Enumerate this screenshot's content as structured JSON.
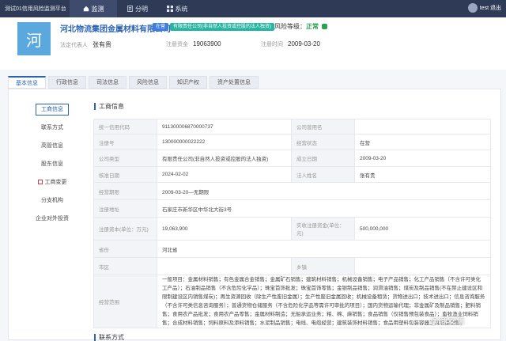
{
  "header": {
    "app_title": "测试01信用风险监测平台",
    "nav": [
      {
        "label": "监测",
        "icon": "home-icon"
      },
      {
        "label": "分明",
        "icon": "document-icon"
      },
      {
        "label": "系统",
        "icon": "grid-icon"
      }
    ],
    "user": "test 退出"
  },
  "company": {
    "logo_char": "河",
    "name": "河北物流集团金属材料有限公司",
    "tag_status": "在营",
    "tag_type": "有限责任公司(非自然人投资或控股的法人独资)",
    "risk_label": "风险等级：",
    "risk_level": "正常",
    "legal_rep_label": "法定代表人",
    "legal_rep": "张有贵",
    "capital_label": "注册资金",
    "capital": "19063900",
    "reg_time_label": "注册时间",
    "reg_time": "2009-03-20"
  },
  "tabs": [
    "基本信息",
    "行政信息",
    "司法信息",
    "风险信息",
    "知识产权",
    "资产处置信息"
  ],
  "sidemenu": [
    "工商信息",
    "联系方式",
    "高管信息",
    "股东信息",
    "工商变更",
    "分支机构",
    "企业对外投资"
  ],
  "section_title": "工商信息",
  "rows": [
    {
      "k1": "统一信用代码",
      "v1": "911300006870000737",
      "k2": "公司曾用名",
      "v2": ""
    },
    {
      "k1": "注册号",
      "v1": "130000000022222",
      "k2": "经营状态",
      "v2": "在营"
    },
    {
      "k1": "公司类型",
      "v1": "有限责任公司(非自然人投资或控股的法人独资)",
      "k2": "成立日期",
      "v2": "2009-03-20"
    },
    {
      "k1": "核准日期",
      "v1": "2024-02-02",
      "k2": "法人姓名",
      "v2": "张有贵"
    },
    {
      "k1": "经营期限",
      "v1": "2009-03-20—无期限"
    },
    {
      "k1": "注册地址",
      "v1": "石家庄市新华区中华北大街3号"
    },
    {
      "k1": "注册资本(单位：万元)",
      "v1": "19,063,900",
      "k2": "实收注册资金(单位：元)",
      "v2": "500,000,000"
    },
    {
      "k1": "省份",
      "v1": "河北省"
    },
    {
      "k1": "市区",
      "v1": "",
      "k2": "乡镇",
      "v2": ""
    }
  ],
  "scope": {
    "k": "经营范围",
    "v": "一般项目：金属材料销售；有色金属合金销售；金属矿石销售；建筑材料销售；机械设备销售；电子产品销售；化工产品销售（不含许可类化工产品）；石油制品销售（不含危险化学品）；珠宝首饰批发；珠宝首饰零售；金银制品销售；润滑油销售；煤炭及制品销售(不在禁止建设区和限制建设区内销售煤炭)；再生资源回收（除生产性废旧金属）；生产性废旧金属回收；机械设备租赁；货物进出口；技术进出口；信息咨询服务（不含许可类信息咨询服务）；普通货物仓储服务（不含危险化学品等需许可审批的项目）；国内货物运输代理；非金属矿及制品销售；肥料销售；食用农产品批发；食用农产品零售；金属材料制造；无船承运业务；粮、棉、麻销售；食品销售（仅销售预包装食品）；畜牧渔业饲料销售；合成材料销售；饲料原料及添料销售；水泥制品销售；电线、电缆经营；建筑装饰材料销售；食品用塑料包装容器工具制品销售。"
  },
  "contact_title": "联系方式",
  "watermark": "@商安信"
}
